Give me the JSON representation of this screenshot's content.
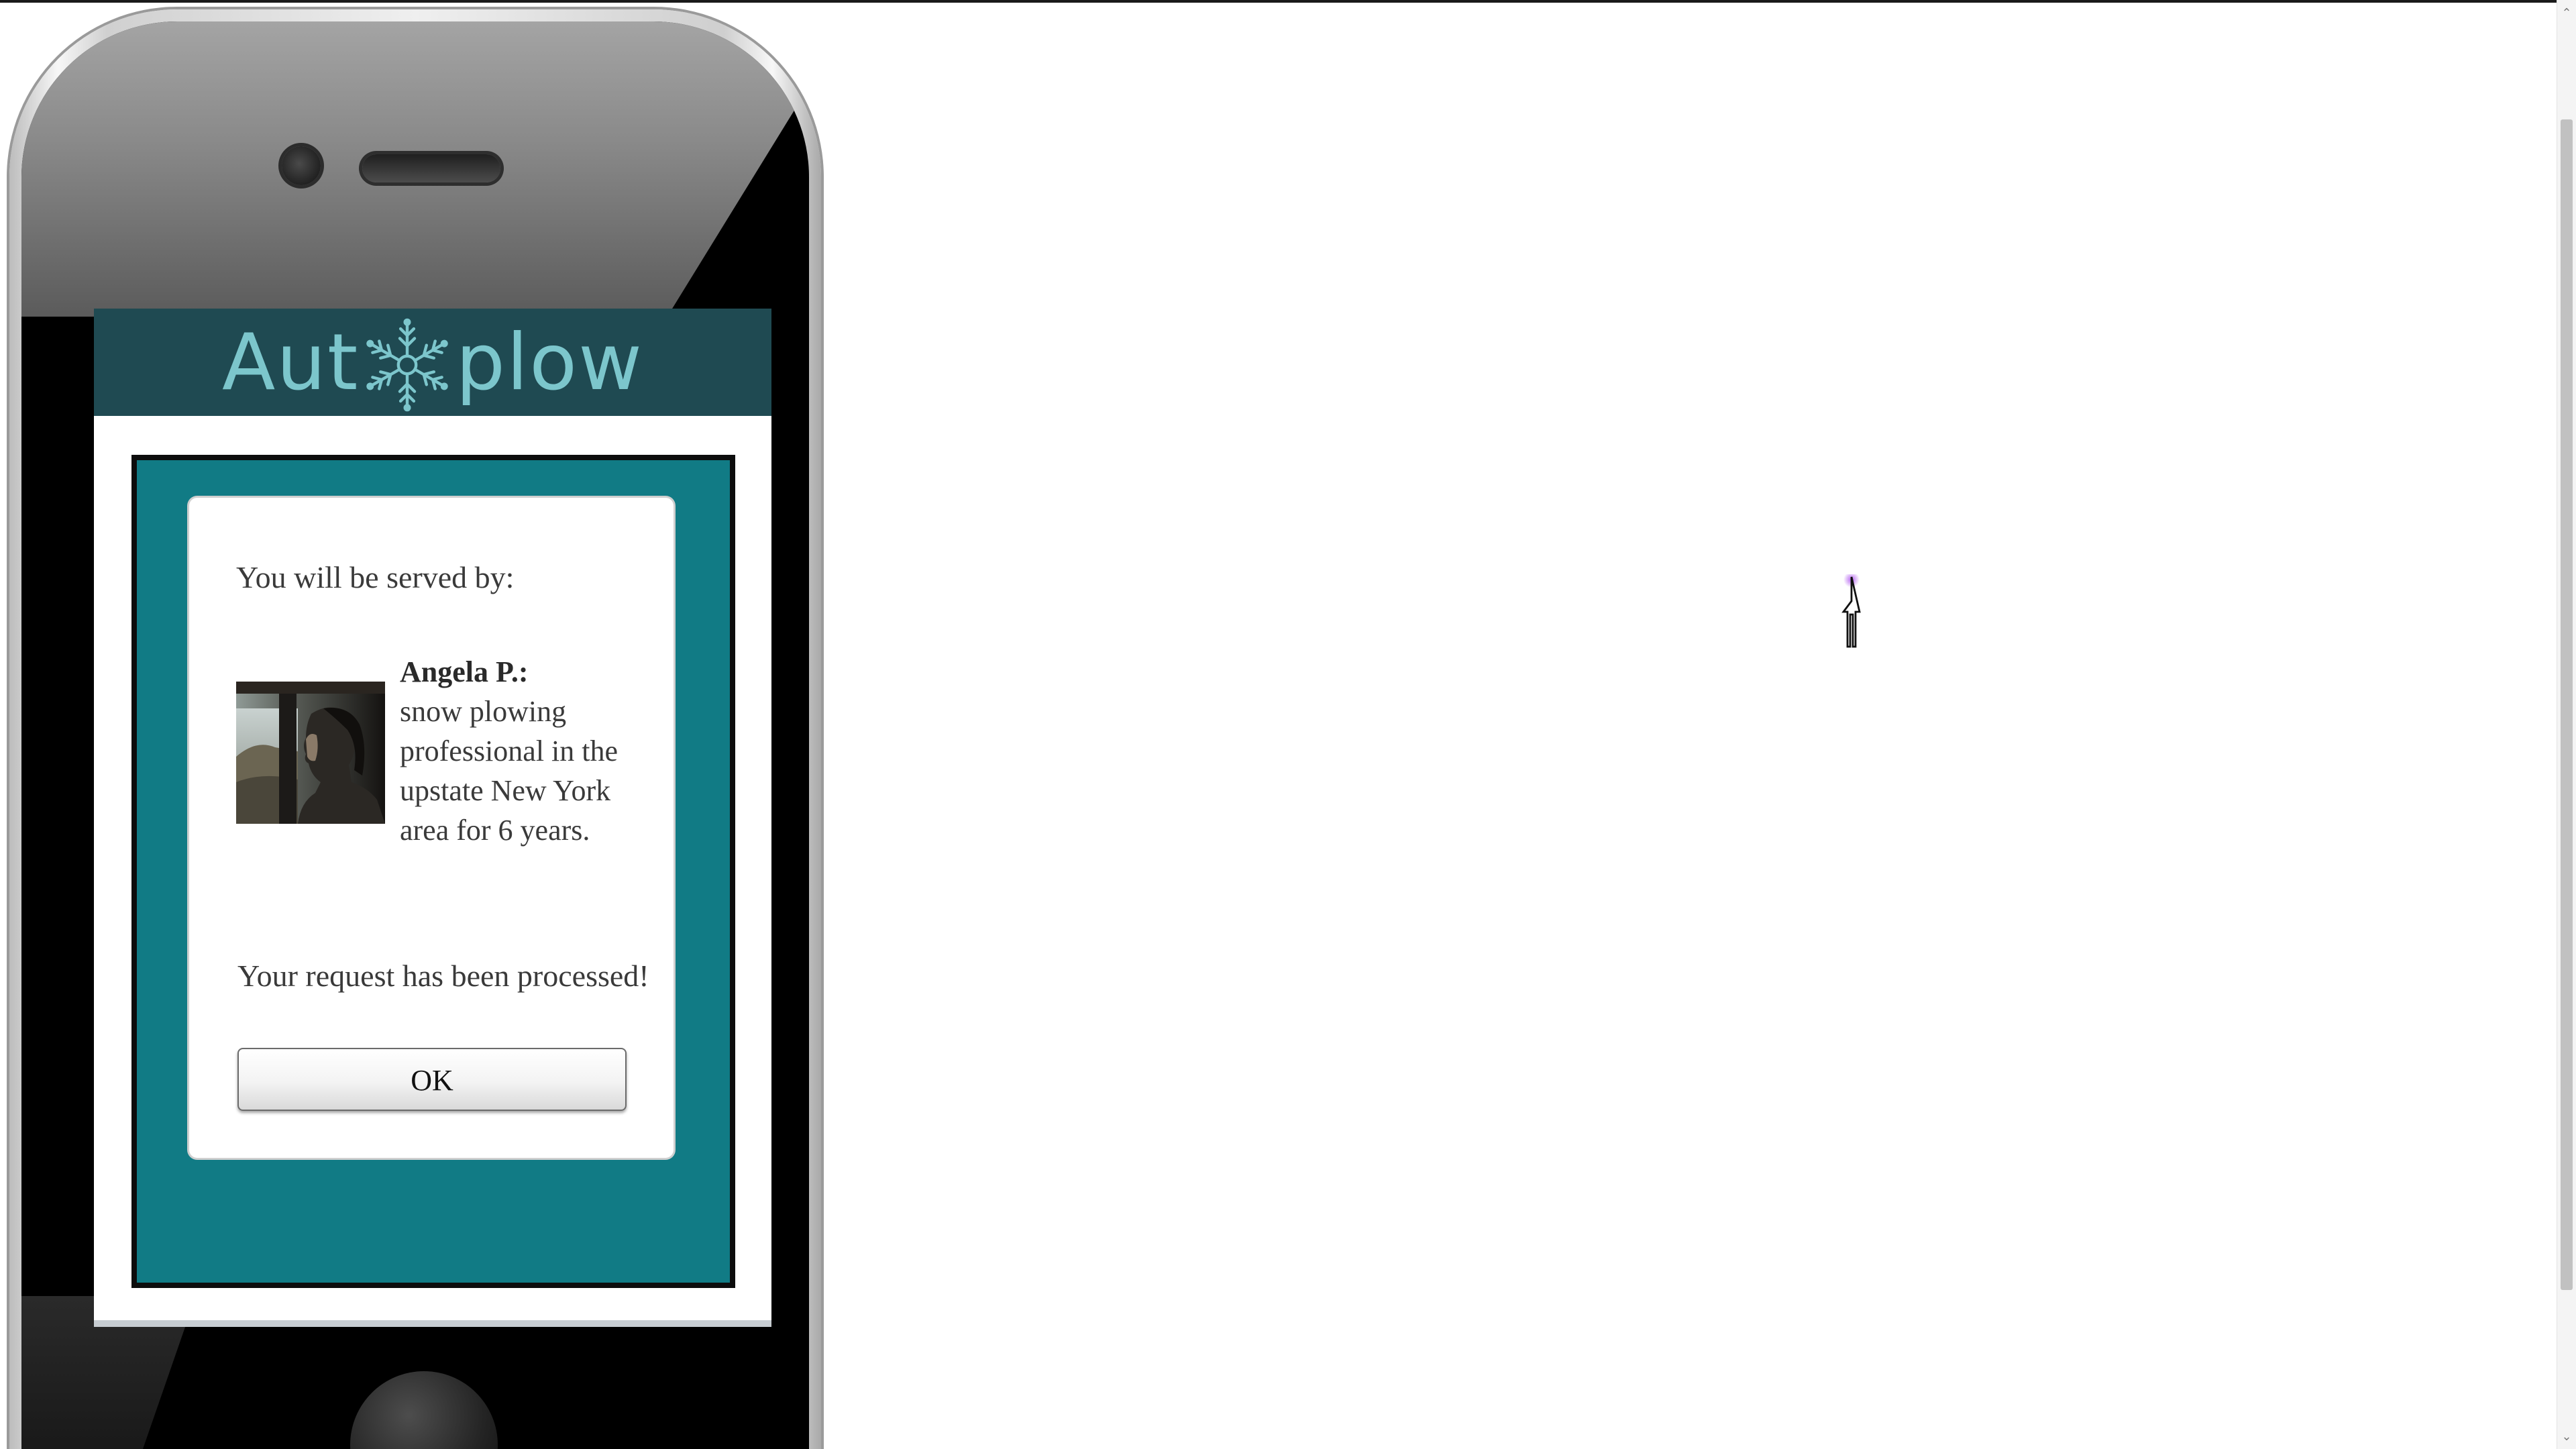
{
  "app": {
    "logo_left": "Aut",
    "logo_right": "plow",
    "logo_icon": "snowflake-icon",
    "colors": {
      "header": "#1f4a52",
      "logo_text": "#7cc6cc",
      "panel": "#117b85"
    }
  },
  "dialog": {
    "served_by_label": "You will be served by:",
    "server_name": "Angela P.:",
    "server_description": "snow plowing professional in the upstate New York area for 6 years.",
    "status_message": "Your request has been processed!",
    "ok_label": "OK"
  },
  "scrollbar": {
    "up_icon": "scroll-up-arrow-icon",
    "down_icon": "scroll-down-arrow-icon"
  },
  "cursor": {
    "icon": "pointer-cursor-icon"
  }
}
